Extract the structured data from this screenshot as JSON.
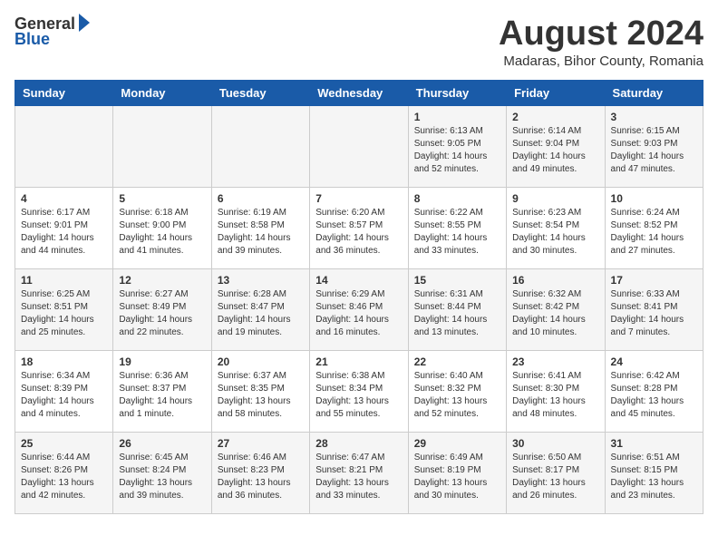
{
  "header": {
    "logo_general": "General",
    "logo_blue": "Blue",
    "month_year": "August 2024",
    "location": "Madaras, Bihor County, Romania"
  },
  "days_of_week": [
    "Sunday",
    "Monday",
    "Tuesday",
    "Wednesday",
    "Thursday",
    "Friday",
    "Saturday"
  ],
  "weeks": [
    [
      {
        "day": "",
        "content": ""
      },
      {
        "day": "",
        "content": ""
      },
      {
        "day": "",
        "content": ""
      },
      {
        "day": "",
        "content": ""
      },
      {
        "day": "1",
        "content": "Sunrise: 6:13 AM\nSunset: 9:05 PM\nDaylight: 14 hours and 52 minutes."
      },
      {
        "day": "2",
        "content": "Sunrise: 6:14 AM\nSunset: 9:04 PM\nDaylight: 14 hours and 49 minutes."
      },
      {
        "day": "3",
        "content": "Sunrise: 6:15 AM\nSunset: 9:03 PM\nDaylight: 14 hours and 47 minutes."
      }
    ],
    [
      {
        "day": "4",
        "content": "Sunrise: 6:17 AM\nSunset: 9:01 PM\nDaylight: 14 hours and 44 minutes."
      },
      {
        "day": "5",
        "content": "Sunrise: 6:18 AM\nSunset: 9:00 PM\nDaylight: 14 hours and 41 minutes."
      },
      {
        "day": "6",
        "content": "Sunrise: 6:19 AM\nSunset: 8:58 PM\nDaylight: 14 hours and 39 minutes."
      },
      {
        "day": "7",
        "content": "Sunrise: 6:20 AM\nSunset: 8:57 PM\nDaylight: 14 hours and 36 minutes."
      },
      {
        "day": "8",
        "content": "Sunrise: 6:22 AM\nSunset: 8:55 PM\nDaylight: 14 hours and 33 minutes."
      },
      {
        "day": "9",
        "content": "Sunrise: 6:23 AM\nSunset: 8:54 PM\nDaylight: 14 hours and 30 minutes."
      },
      {
        "day": "10",
        "content": "Sunrise: 6:24 AM\nSunset: 8:52 PM\nDaylight: 14 hours and 27 minutes."
      }
    ],
    [
      {
        "day": "11",
        "content": "Sunrise: 6:25 AM\nSunset: 8:51 PM\nDaylight: 14 hours and 25 minutes."
      },
      {
        "day": "12",
        "content": "Sunrise: 6:27 AM\nSunset: 8:49 PM\nDaylight: 14 hours and 22 minutes."
      },
      {
        "day": "13",
        "content": "Sunrise: 6:28 AM\nSunset: 8:47 PM\nDaylight: 14 hours and 19 minutes."
      },
      {
        "day": "14",
        "content": "Sunrise: 6:29 AM\nSunset: 8:46 PM\nDaylight: 14 hours and 16 minutes."
      },
      {
        "day": "15",
        "content": "Sunrise: 6:31 AM\nSunset: 8:44 PM\nDaylight: 14 hours and 13 minutes."
      },
      {
        "day": "16",
        "content": "Sunrise: 6:32 AM\nSunset: 8:42 PM\nDaylight: 14 hours and 10 minutes."
      },
      {
        "day": "17",
        "content": "Sunrise: 6:33 AM\nSunset: 8:41 PM\nDaylight: 14 hours and 7 minutes."
      }
    ],
    [
      {
        "day": "18",
        "content": "Sunrise: 6:34 AM\nSunset: 8:39 PM\nDaylight: 14 hours and 4 minutes."
      },
      {
        "day": "19",
        "content": "Sunrise: 6:36 AM\nSunset: 8:37 PM\nDaylight: 14 hours and 1 minute."
      },
      {
        "day": "20",
        "content": "Sunrise: 6:37 AM\nSunset: 8:35 PM\nDaylight: 13 hours and 58 minutes."
      },
      {
        "day": "21",
        "content": "Sunrise: 6:38 AM\nSunset: 8:34 PM\nDaylight: 13 hours and 55 minutes."
      },
      {
        "day": "22",
        "content": "Sunrise: 6:40 AM\nSunset: 8:32 PM\nDaylight: 13 hours and 52 minutes."
      },
      {
        "day": "23",
        "content": "Sunrise: 6:41 AM\nSunset: 8:30 PM\nDaylight: 13 hours and 48 minutes."
      },
      {
        "day": "24",
        "content": "Sunrise: 6:42 AM\nSunset: 8:28 PM\nDaylight: 13 hours and 45 minutes."
      }
    ],
    [
      {
        "day": "25",
        "content": "Sunrise: 6:44 AM\nSunset: 8:26 PM\nDaylight: 13 hours and 42 minutes."
      },
      {
        "day": "26",
        "content": "Sunrise: 6:45 AM\nSunset: 8:24 PM\nDaylight: 13 hours and 39 minutes."
      },
      {
        "day": "27",
        "content": "Sunrise: 6:46 AM\nSunset: 8:23 PM\nDaylight: 13 hours and 36 minutes."
      },
      {
        "day": "28",
        "content": "Sunrise: 6:47 AM\nSunset: 8:21 PM\nDaylight: 13 hours and 33 minutes."
      },
      {
        "day": "29",
        "content": "Sunrise: 6:49 AM\nSunset: 8:19 PM\nDaylight: 13 hours and 30 minutes."
      },
      {
        "day": "30",
        "content": "Sunrise: 6:50 AM\nSunset: 8:17 PM\nDaylight: 13 hours and 26 minutes."
      },
      {
        "day": "31",
        "content": "Sunrise: 6:51 AM\nSunset: 8:15 PM\nDaylight: 13 hours and 23 minutes."
      }
    ]
  ]
}
